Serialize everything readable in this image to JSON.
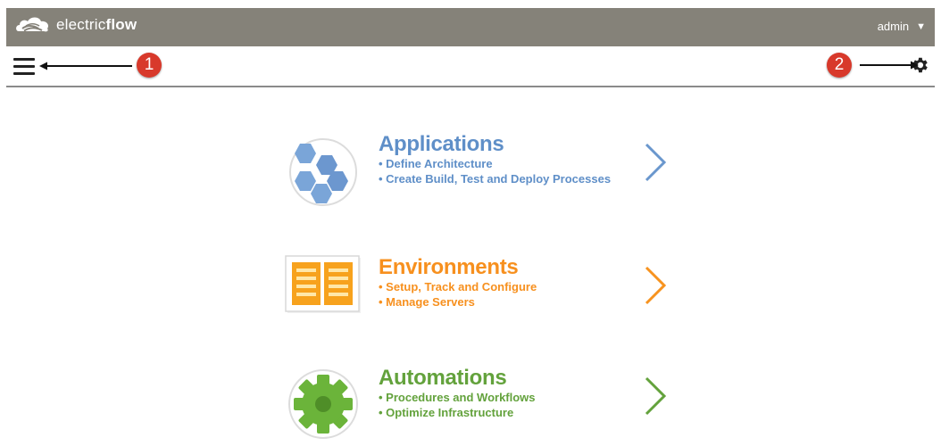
{
  "header": {
    "logo_light": "electric",
    "logo_bold": "flow",
    "user": "admin",
    "caret": "▼"
  },
  "annotations": {
    "one": "1",
    "two": "2"
  },
  "cards": [
    {
      "title": "Applications",
      "bullets": [
        "• Define Architecture",
        "• Create Build, Test and Deploy Processes"
      ],
      "color": "#5f8fc8",
      "icon": "hexagons-icon"
    },
    {
      "title": "Environments",
      "bullets": [
        "• Setup, Track and Configure",
        "• Manage Servers"
      ],
      "color": "#f7901e",
      "icon": "server-racks-icon"
    },
    {
      "title": "Automations",
      "bullets": [
        "• Procedures and Workflows",
        "• Optimize Infrastructure"
      ],
      "color": "#63a23c",
      "icon": "green-gear-icon"
    }
  ]
}
